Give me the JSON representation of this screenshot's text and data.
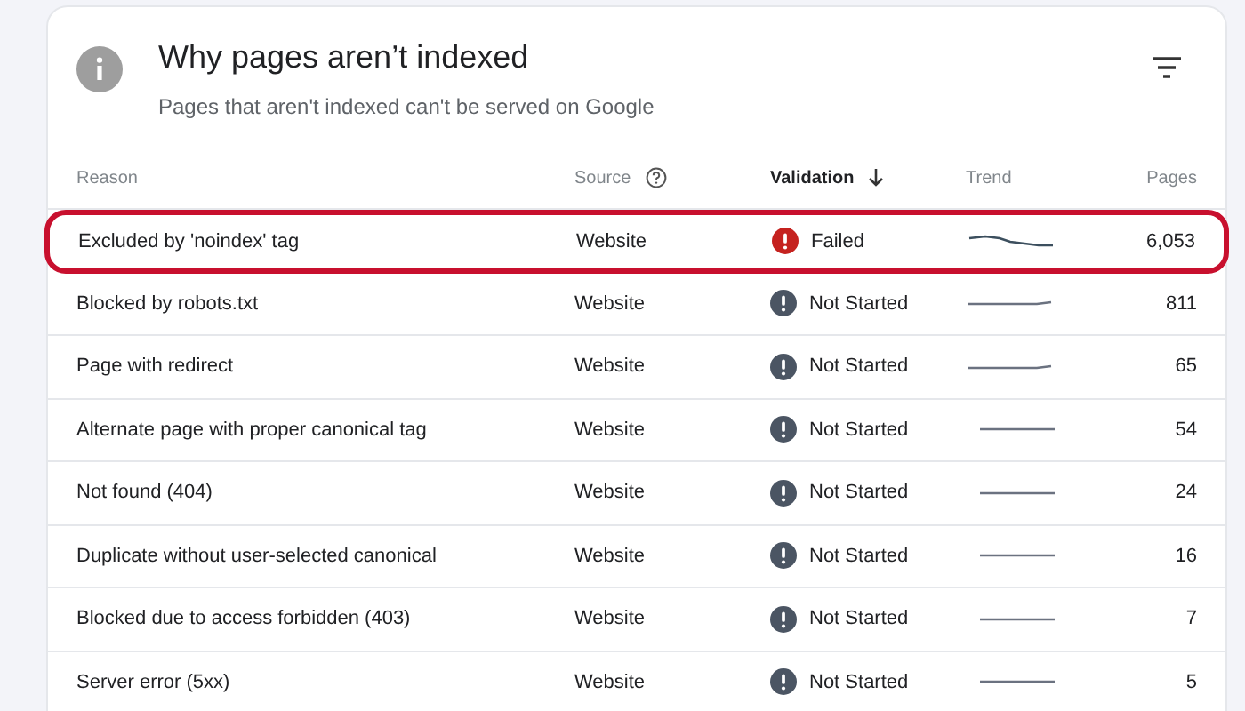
{
  "card": {
    "title": "Why pages aren’t indexed",
    "subtitle": "Pages that aren't indexed can't be served on Google"
  },
  "table": {
    "columns": [
      {
        "label": "Reason",
        "kind": "plain"
      },
      {
        "label": "Source",
        "kind": "help"
      },
      {
        "label": "Validation",
        "kind": "sorted"
      },
      {
        "label": "Trend",
        "kind": "plain"
      },
      {
        "label": "Pages",
        "kind": "plain"
      }
    ],
    "rows": [
      {
        "reason": "Excluded by 'noindex' tag",
        "source": "Website",
        "kind": "failed",
        "validation": "Failed",
        "pages": "6,053",
        "highlighted": true
      },
      {
        "reason": "Blocked by robots.txt",
        "source": "Website",
        "kind": "not_started",
        "validation": "Not Started",
        "pages": "811",
        "highlighted": false
      },
      {
        "reason": "Page with redirect",
        "source": "Website",
        "kind": "not_started",
        "validation": "Not Started",
        "pages": "65",
        "highlighted": false
      },
      {
        "reason": "Alternate page with proper canonical tag",
        "source": "Website",
        "kind": "not_started",
        "validation": "Not Started",
        "pages": "54",
        "highlighted": false
      },
      {
        "reason": "Not found (404)",
        "source": "Website",
        "kind": "not_started",
        "validation": "Not Started",
        "pages": "24",
        "highlighted": false
      },
      {
        "reason": "Duplicate without user-selected canonical",
        "source": "Website",
        "kind": "not_started",
        "validation": "Not Started",
        "pages": "16",
        "highlighted": false
      },
      {
        "reason": "Blocked due to access forbidden (403)",
        "source": "Website",
        "kind": "not_started",
        "validation": "Not Started",
        "pages": "7",
        "highlighted": false
      },
      {
        "reason": "Server error (5xx)",
        "source": "Website",
        "kind": "not_started",
        "validation": "Not Started",
        "pages": "5",
        "highlighted": false
      }
    ]
  }
}
